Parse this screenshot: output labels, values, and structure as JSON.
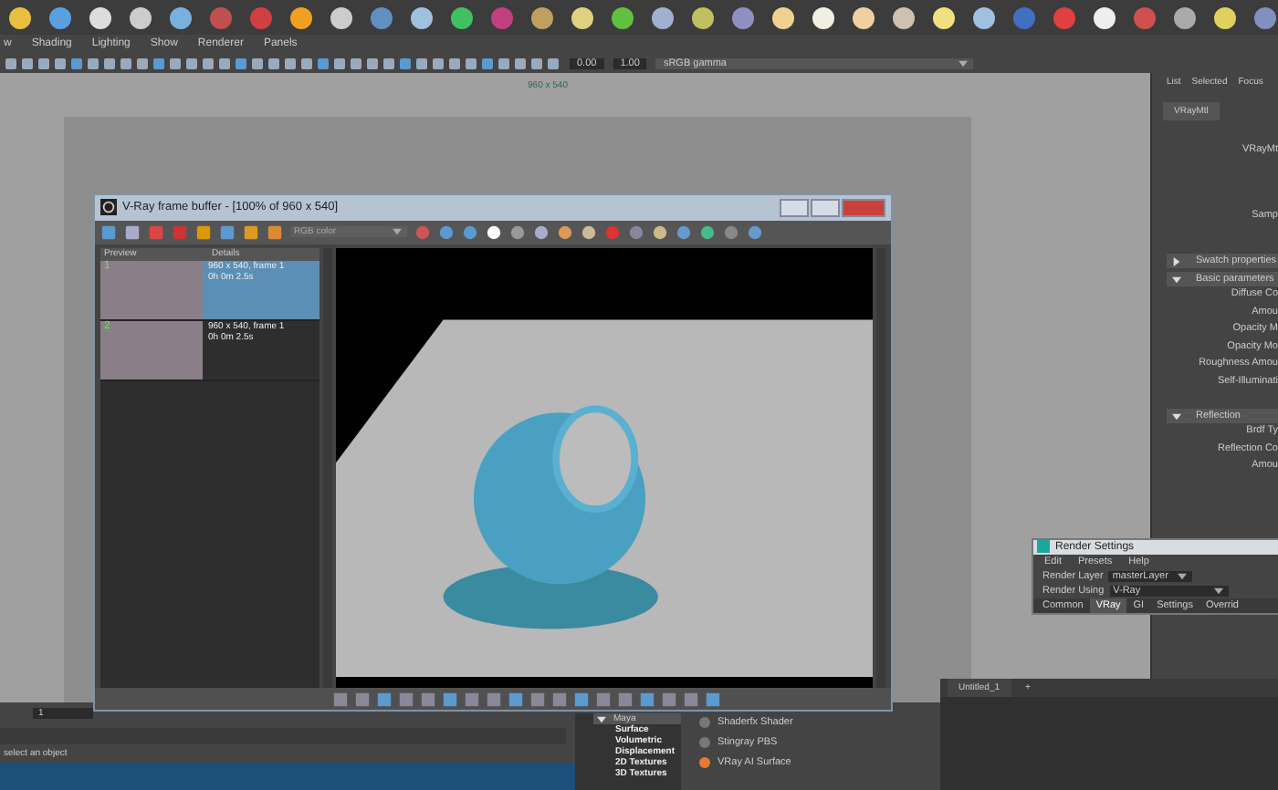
{
  "viewport_menu": [
    "w",
    "Shading",
    "Lighting",
    "Show",
    "Renderer",
    "Panels"
  ],
  "viewport_toolbar": {
    "exposure": "0.00",
    "gamma": "1.00",
    "color_space": "sRGB gamma"
  },
  "viewport": {
    "resolution_label": "960 x 540"
  },
  "attribute_editor": {
    "header_buttons": [
      "List",
      "Selected",
      "Focus"
    ],
    "tab": "VRayMtl",
    "top_labels": [
      "VRayMt",
      "Samp"
    ],
    "sections": [
      {
        "title": "Swatch properties",
        "expanded": false
      },
      {
        "title": "Basic parameters",
        "expanded": true,
        "fields": [
          "Diffuse Co",
          "Amou",
          "Opacity M",
          "Opacity Mo",
          "Roughness Amou",
          "Self-Illuminati"
        ]
      },
      {
        "title": "Reflection",
        "expanded": true,
        "fields": [
          "Brdf Ty",
          "Reflection Co",
          "Amou"
        ]
      }
    ]
  },
  "frame_buffer": {
    "title": "V-Ray frame buffer - [100% of 960 x 540]",
    "channel": "RGB color",
    "columns": [
      "Preview",
      "Details"
    ],
    "history": [
      {
        "number": "1",
        "details": "960 x 540, frame 1",
        "time": "0h 0m 2.5s",
        "selected": true
      },
      {
        "number": "2",
        "details": "960 x 540, frame 1",
        "time": "0h 0m 2.5s",
        "selected": false
      }
    ]
  },
  "render_settings": {
    "title": "Render Settings",
    "menu": [
      "Edit",
      "Presets",
      "Help"
    ],
    "render_layer_label": "Render Layer",
    "render_layer": "masterLayer",
    "render_using_label": "Render Using",
    "render_using": "V-Ray",
    "tabs": [
      {
        "label": "Common",
        "selected": false
      },
      {
        "label": "VRay",
        "selected": true
      },
      {
        "label": "GI",
        "selected": false
      },
      {
        "label": "Settings",
        "selected": false
      },
      {
        "label": "Overrid",
        "selected": false
      }
    ]
  },
  "hypershade": {
    "tree": {
      "label": "Maya",
      "expanded": true,
      "children": [
        "Surface",
        "Volumetric",
        "Displacement",
        "2D Textures",
        "3D Textures"
      ]
    },
    "materials": [
      "Shaderfx Shader",
      "Stingray PBS",
      "VRay AI Surface"
    ],
    "tabs": [
      "Untitled_1",
      "+"
    ]
  },
  "timeline": {
    "frame": "1"
  },
  "help_line": "select an object"
}
